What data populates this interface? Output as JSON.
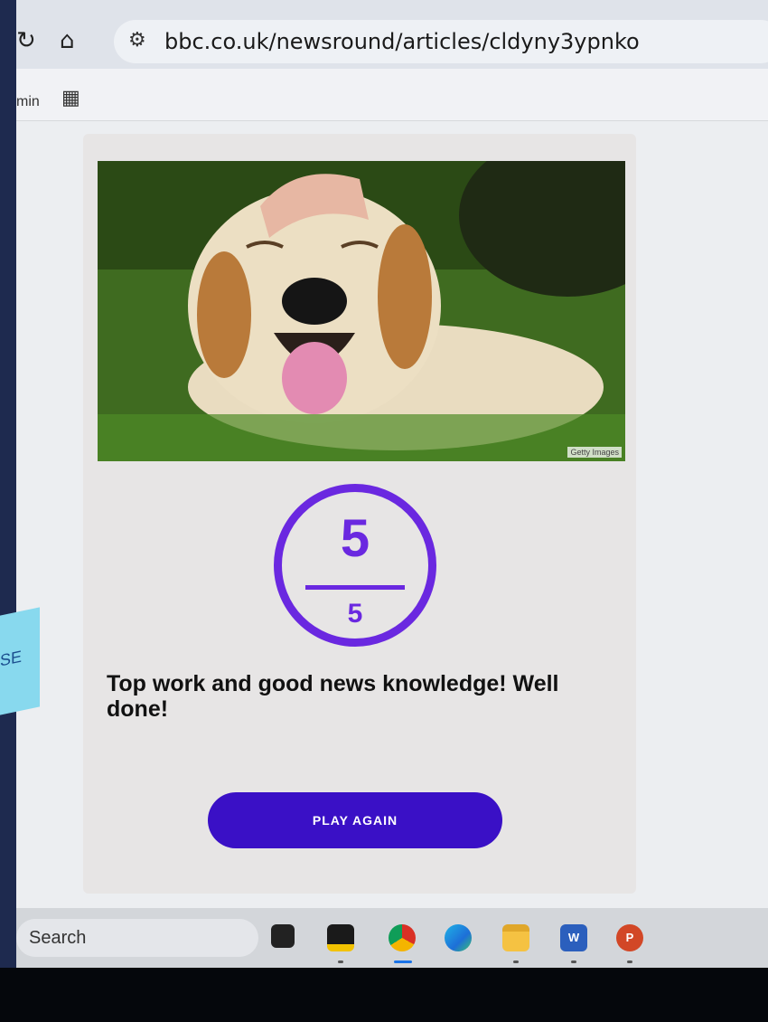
{
  "browser": {
    "url": "bbc.co.uk/newsround/articles/cldyny3ypnko",
    "bookmark_text": "min"
  },
  "article": {
    "image_credit": "Getty Images",
    "score": {
      "correct": "5",
      "total": "5"
    },
    "message": "Top work and good news knowledge! Well done!",
    "play_again_label": "PLAY AGAIN"
  },
  "taskbar": {
    "search_label": "Search",
    "apps": [
      "task-view-icon",
      "sticky-notes-icon",
      "chrome-icon",
      "edge-icon",
      "file-explorer-icon",
      "word-icon",
      "powerpoint-icon"
    ]
  },
  "sticky_note": {
    "text": "SE"
  },
  "colors": {
    "accent": "#6a28e0",
    "button": "#3a10c6"
  }
}
